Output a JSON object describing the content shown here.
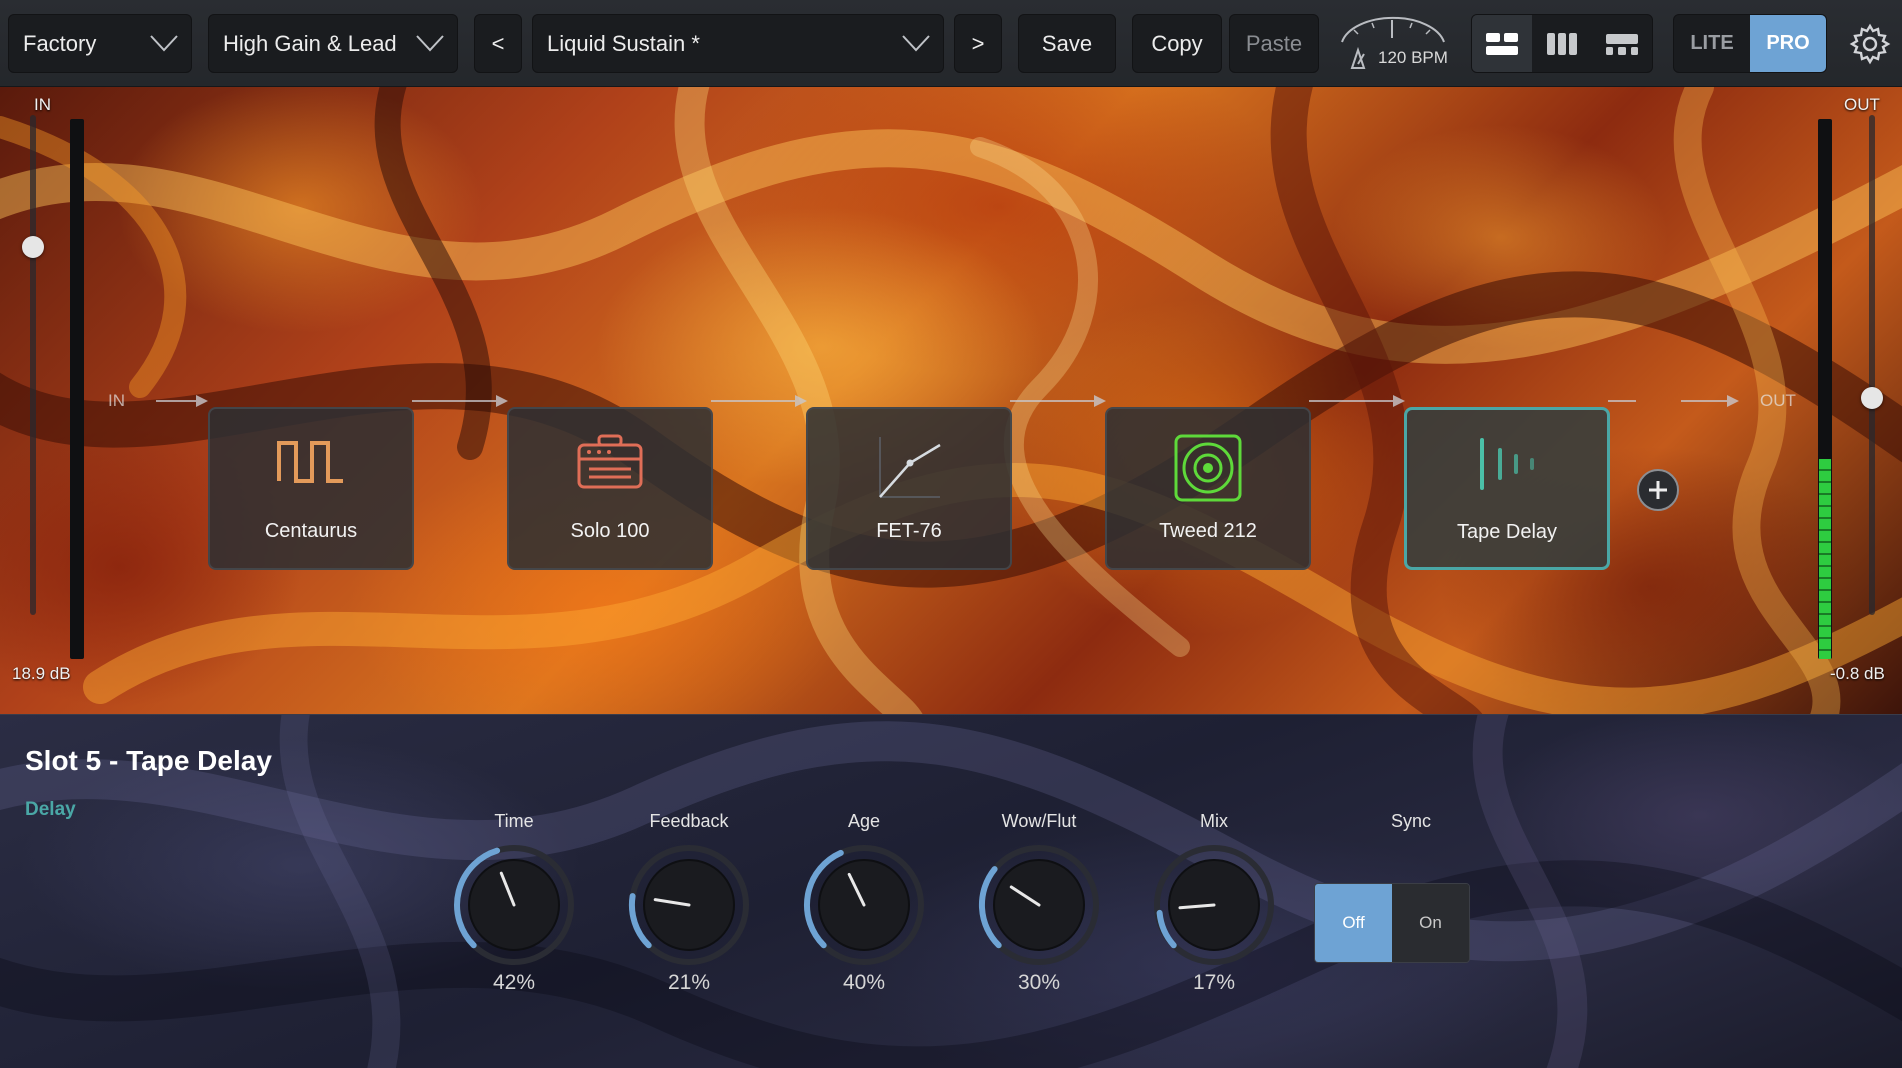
{
  "topbar": {
    "bank": "Factory",
    "category": "High Gain & Lead",
    "prev_label": "<",
    "preset": "Liquid Sustain *",
    "next_label": ">",
    "save_label": "Save",
    "copy_label": "Copy",
    "paste_label": "Paste",
    "tempo": "120 BPM",
    "mode_lite": "LITE",
    "mode_pro": "PRO",
    "active_mode": "PRO"
  },
  "input": {
    "label": "IN",
    "level_db": "18.9 dB",
    "chain_label": "IN"
  },
  "output": {
    "label": "OUT",
    "level_db": "-0.8 dB",
    "chain_label": "OUT"
  },
  "chain": {
    "slots": [
      {
        "label": "Centaurus",
        "icon": "square-wave-icon"
      },
      {
        "label": "Solo 100",
        "icon": "amp-head-icon"
      },
      {
        "label": "FET-76",
        "icon": "compressor-curve-icon"
      },
      {
        "label": "Tweed 212",
        "icon": "speaker-cabinet-icon"
      },
      {
        "label": "Tape Delay",
        "icon": "delay-taps-icon"
      }
    ],
    "selected_index": 4
  },
  "editor": {
    "title": "Slot 5 - Tape Delay",
    "category": "Delay",
    "knobs": [
      {
        "label": "Time",
        "value": "42%"
      },
      {
        "label": "Feedback",
        "value": "21%"
      },
      {
        "label": "Age",
        "value": "40%"
      },
      {
        "label": "Wow/Flut",
        "value": "30%"
      },
      {
        "label": "Mix",
        "value": "17%"
      }
    ],
    "sync": {
      "label": "Sync",
      "off_label": "Off",
      "on_label": "On",
      "active": "Off"
    }
  },
  "colors": {
    "accent": "#6ea3d4",
    "selected_slot": "#4aa7a6",
    "meter_green": "#2ecc40"
  }
}
